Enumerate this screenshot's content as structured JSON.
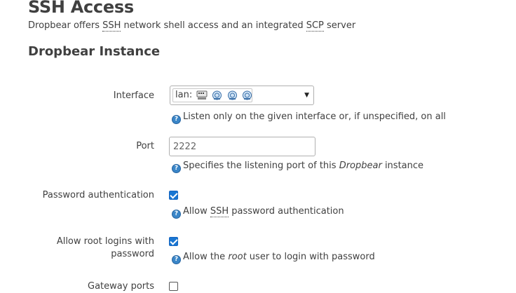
{
  "page": {
    "title": "SSH Access",
    "description_prefix": "Dropbear offers ",
    "description_abbr1": "SSH",
    "description_middle": " network shell access and an integrated ",
    "description_abbr2": "SCP",
    "description_suffix": " server"
  },
  "section": {
    "title": "Dropbear Instance"
  },
  "fields": {
    "interface": {
      "label": "Interface",
      "value": "lan:",
      "icons": [
        "network-icon",
        "network-icon",
        "network-icon",
        "network-icon"
      ],
      "help": "Listen only on the given interface or, if unspecified, on all"
    },
    "port": {
      "label": "Port",
      "value": "2222",
      "help_prefix": "Specifies the listening port of this ",
      "help_em": "Dropbear",
      "help_suffix": " instance"
    },
    "password_auth": {
      "label": "Password authentication",
      "checked": true,
      "help_prefix": "Allow ",
      "help_abbr": "SSH",
      "help_suffix": " password authentication"
    },
    "root_password": {
      "label_line1": "Allow root logins with",
      "label_line2": "password",
      "checked": true,
      "help_prefix": "Allow the ",
      "help_em": "root",
      "help_suffix": " user to login with password"
    },
    "gateway_ports": {
      "label": "Gateway ports",
      "checked": false
    }
  },
  "colors": {
    "text": "#404040",
    "accent": "#1976d2",
    "help_icon": "#3a86c8"
  }
}
